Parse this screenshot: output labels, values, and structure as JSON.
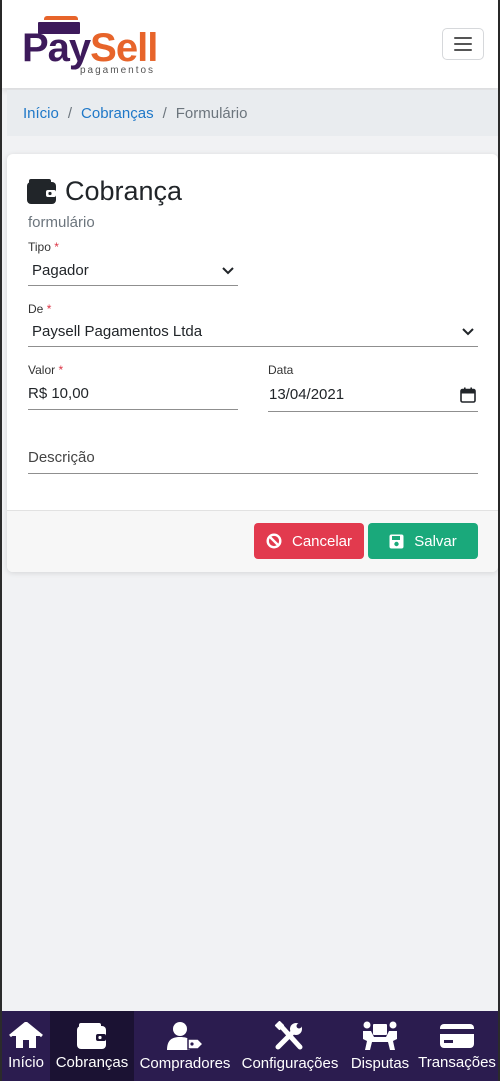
{
  "brand": {
    "name_part1": "Pay",
    "name_part2": "Sell",
    "tagline": "pagamentos"
  },
  "breadcrumb": {
    "items": [
      "Início",
      "Cobranças"
    ],
    "current": "Formulário"
  },
  "form": {
    "title": "Cobrança",
    "subtitle": "formulário",
    "tipo": {
      "label": "Tipo",
      "value": "Pagador"
    },
    "de": {
      "label": "De",
      "value": "Paysell Pagamentos Ltda"
    },
    "valor": {
      "label": "Valor",
      "value": "R$ 10,00"
    },
    "data": {
      "label": "Data",
      "value": "13/04/2021"
    },
    "descricao": {
      "placeholder": "Descrição"
    },
    "required_mark": "*"
  },
  "actions": {
    "cancel_label": "Cancelar",
    "save_label": "Salvar"
  },
  "bottom_nav": [
    {
      "label": "Início",
      "icon": "home-icon",
      "active": false
    },
    {
      "label": "Cobranças",
      "icon": "wallet-icon",
      "active": true
    },
    {
      "label": "Compradores",
      "icon": "user-tag-icon",
      "active": false
    },
    {
      "label": "Configurações",
      "icon": "tools-icon",
      "active": false
    },
    {
      "label": "Disputas",
      "icon": "people-carry-icon",
      "active": false
    },
    {
      "label": "Transações",
      "icon": "credit-card-icon",
      "active": false
    }
  ],
  "colors": {
    "brand_purple": "#3d1a5b",
    "brand_orange": "#e7642a",
    "nav_bg": "#2b1c4f",
    "cancel": "#e23a4e",
    "save": "#1aa97b",
    "link": "#1f78c8"
  }
}
